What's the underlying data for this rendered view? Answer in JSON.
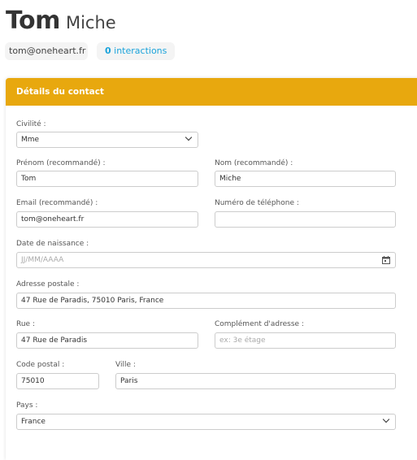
{
  "header": {
    "first_name": "Tom",
    "last_name": "Miche",
    "email_chip": "tom@oneheart.fr",
    "interactions_count": "0",
    "interactions_label": "interactions"
  },
  "card": {
    "title": "Détails du contact",
    "header_color": "#e8a80e"
  },
  "form": {
    "civilite": {
      "label": "Civilité :",
      "value": "Mme"
    },
    "prenom": {
      "label": "Prénom (recommandé) :",
      "value": "Tom"
    },
    "nom": {
      "label": "Nom (recommandé) :",
      "value": "Miche"
    },
    "email": {
      "label": "Email (recommandé) :",
      "value": "tom@oneheart.fr"
    },
    "telephone": {
      "label": "Numéro de téléphone :",
      "value": ""
    },
    "naissance": {
      "label": "Date de naissance :",
      "placeholder": "JJ/MM/AAAA"
    },
    "adresse": {
      "label": "Adresse postale :",
      "value": "47 Rue de Paradis, 75010 Paris, France"
    },
    "rue": {
      "label": "Rue :",
      "value": "47 Rue de Paradis"
    },
    "complement": {
      "label": "Complément d'adresse :",
      "placeholder": "ex: 3e étage"
    },
    "code_postal": {
      "label": "Code postal :",
      "value": "75010"
    },
    "ville": {
      "label": "Ville :",
      "value": "Paris"
    },
    "pays": {
      "label": "Pays :",
      "value": "France"
    }
  },
  "accent_color": "#1aa3db"
}
